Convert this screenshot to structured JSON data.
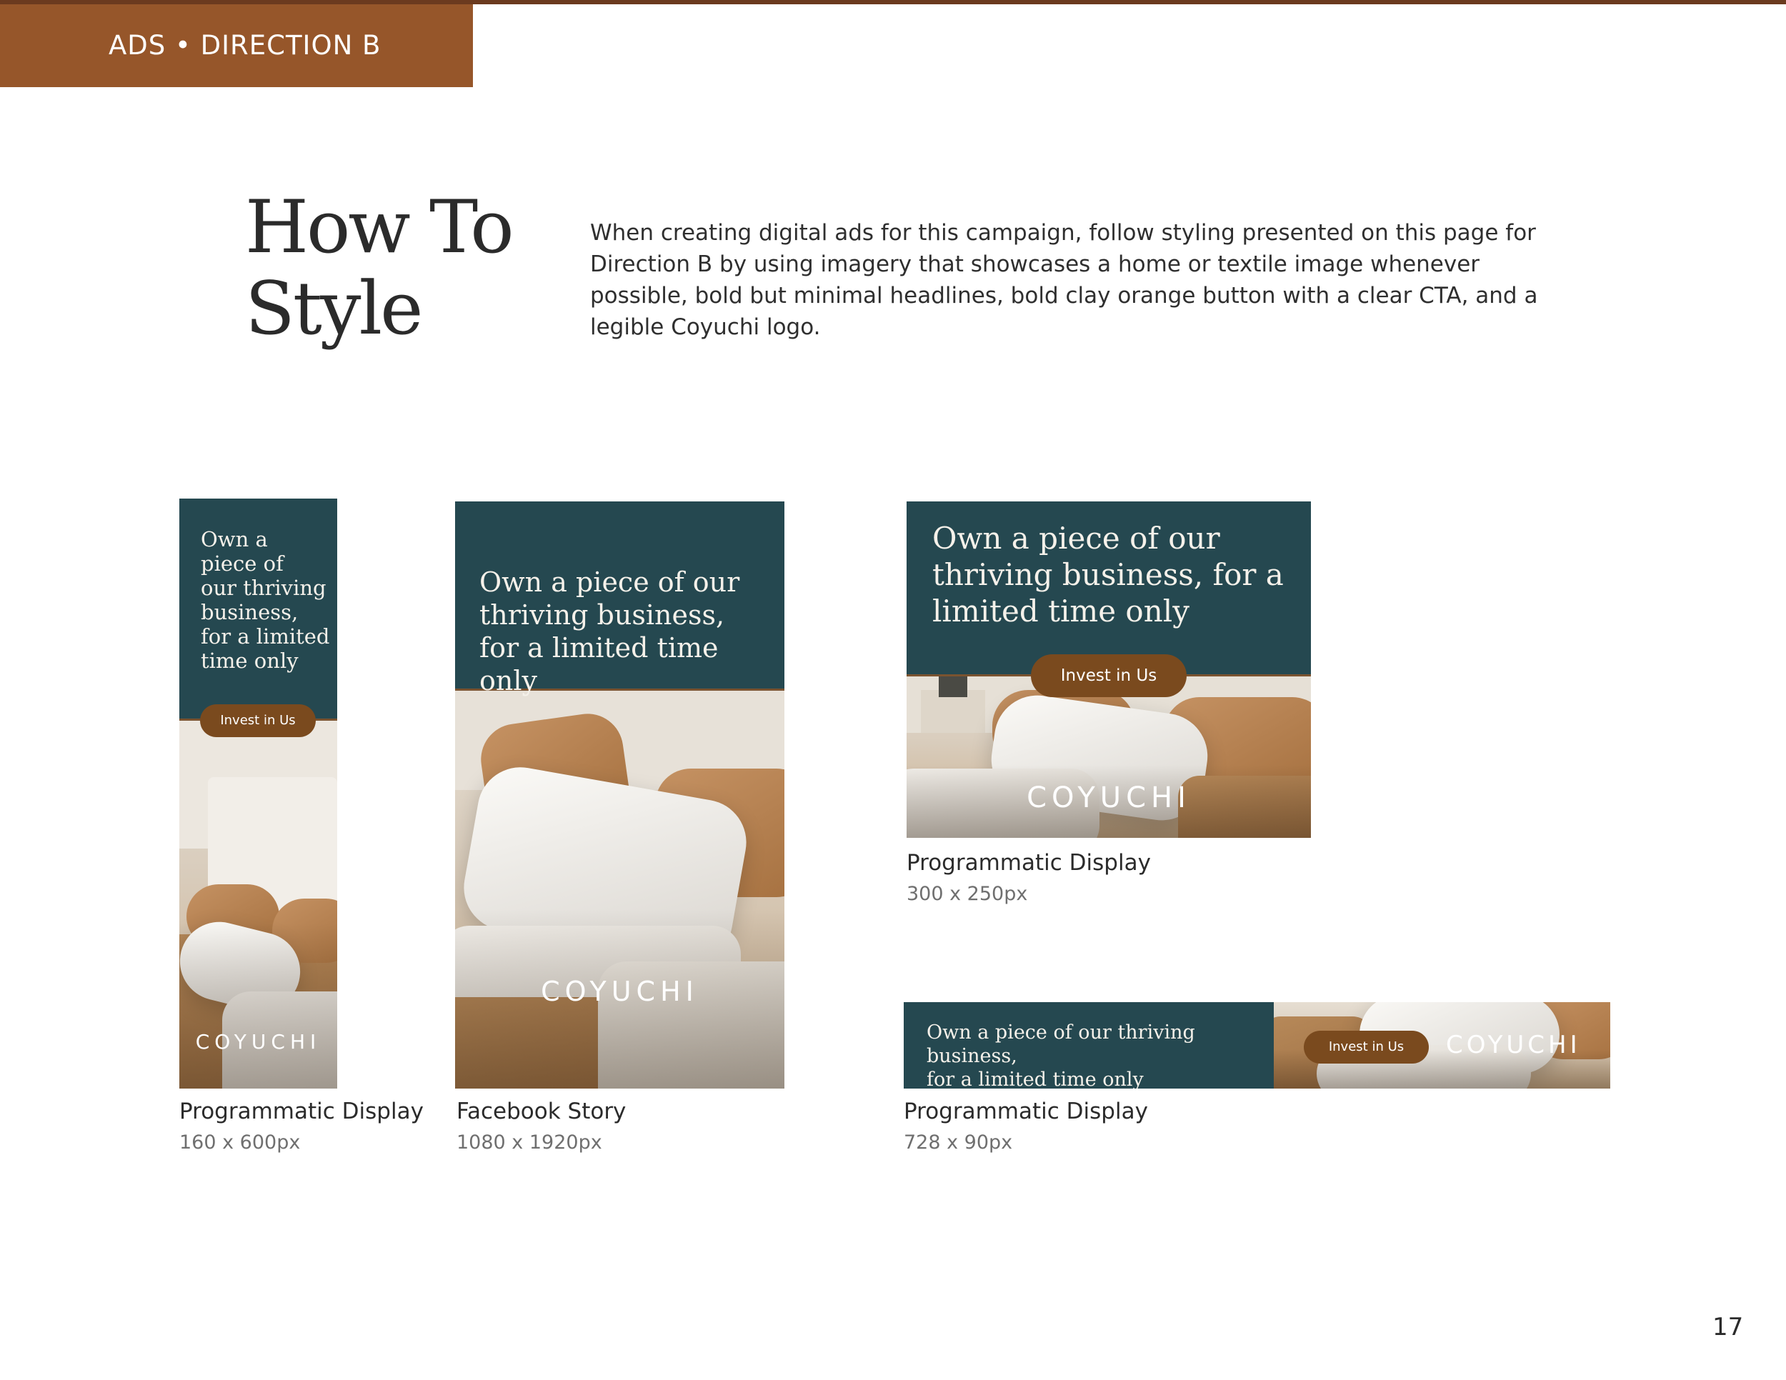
{
  "header": {
    "section_label": "ADS • DIRECTION B"
  },
  "title": {
    "line1": "How To",
    "line2": "Style"
  },
  "intro": "When creating digital ads for this campaign, follow styling presented on this page for Direction B by using imagery that showcases a home or textile image whenever possible, bold but minimal headlines, bold clay orange button with a clear CTA, and a legible Coyuchi logo.",
  "ads": {
    "skyscraper": {
      "headline_lines": [
        "Own a",
        "piece of",
        "our thriving",
        "business,",
        "for a limited",
        "time only"
      ],
      "cta": "Invest in Us",
      "logo": "COYUCHI",
      "caption": "Programmatic Display",
      "size": "160 x 600px"
    },
    "story": {
      "headline_lines": [
        "Own a piece of our",
        "thriving business,",
        "for a limited time only"
      ],
      "logo": "COYUCHI",
      "caption": "Facebook Story",
      "size": "1080 x 1920px"
    },
    "rectangle": {
      "headline_lines": [
        "Own a piece of our",
        "thriving business, for a",
        "limited time only"
      ],
      "cta": "Invest in Us",
      "logo": "COYUCHI",
      "caption": "Programmatic Display",
      "size": "300 x 250px"
    },
    "leaderboard": {
      "headline_lines": [
        "Own a piece of our thriving business,",
        "for a limited time only"
      ],
      "cta": "Invest in Us",
      "logo": "COYUCHI",
      "caption": "Programmatic Display",
      "size": "728 x 90px"
    }
  },
  "colors": {
    "teal": "#254850",
    "clay": "#96562a",
    "cta_brown": "#7a4a1e"
  },
  "page_number": "17"
}
